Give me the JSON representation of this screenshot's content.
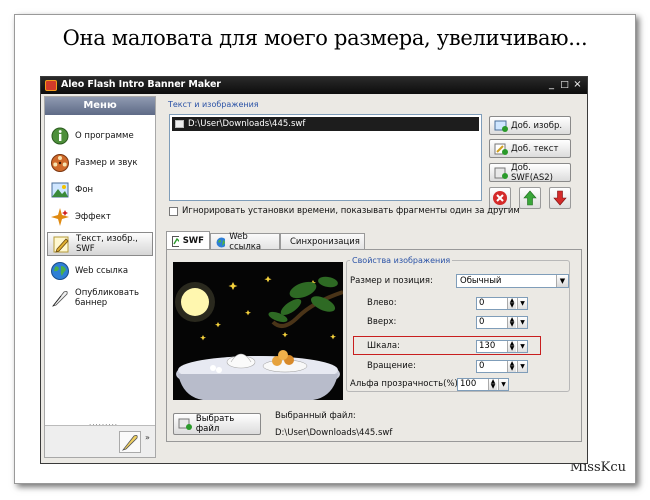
{
  "caption": "Она маловата для моего размера, увеличиваю...",
  "watermark": "MissKcu",
  "window": {
    "title": "Aleo Flash Intro Banner Maker",
    "buttons": [
      "_",
      "□",
      "×"
    ]
  },
  "sidebar": {
    "header": "Меню",
    "items": [
      {
        "label": "О программе",
        "icon": "info-icon"
      },
      {
        "label": "Размер и звук",
        "icon": "film-reel-icon"
      },
      {
        "label": "Фон",
        "icon": "picture-icon"
      },
      {
        "label": "Эффект",
        "icon": "sparkle-icon"
      },
      {
        "label": "Текст, изобр., SWF",
        "icon": "pencil-icon",
        "active": true
      },
      {
        "label": "Web ссылка",
        "icon": "globe-icon"
      },
      {
        "label": "Опубликовать баннер",
        "icon": "quill-icon"
      }
    ],
    "more": "»"
  },
  "content": {
    "group_label": "Текст и изображения",
    "files": [
      "D:\\User\\Downloads\\445.swf"
    ],
    "buttons": {
      "add_image": "Доб. изобр.",
      "add_text": "Доб. текст",
      "add_swf": "Доб. SWF(AS2)"
    },
    "ignore_checkbox": "Игнорировать установки времени, показывать фрагменты один за другим",
    "ignore_checked": false
  },
  "tabs": [
    {
      "label": "SWF",
      "icon": "swf-icon",
      "active": true
    },
    {
      "label": "Web ссылка",
      "icon": "globe-icon",
      "active": false
    },
    {
      "label": "Синхронизация",
      "icon": "clock-icon",
      "active": false
    }
  ],
  "swf_panel": {
    "select_file_button": "Выбрать файл",
    "selected_label": "Выбранный файл:",
    "selected_path": "D:\\User\\Downloads\\445.swf",
    "props": {
      "legend": "Свойства изображения",
      "size_pos_label": "Размер и позиция:",
      "size_pos_value": "Обычный",
      "left_label": "Влево:",
      "left_value": "0",
      "up_label": "Вверх:",
      "up_value": "0",
      "scale_label": "Шкала:",
      "scale_value": "130",
      "rotate_label": "Вращение:",
      "rotate_value": "0",
      "alpha_label": "Альфа прозрачность(%):",
      "alpha_value": "100"
    }
  },
  "colors": {
    "titlebar": "#0c0c0c",
    "highlight": "#c81e1e",
    "group_label": "#2a52a6"
  }
}
